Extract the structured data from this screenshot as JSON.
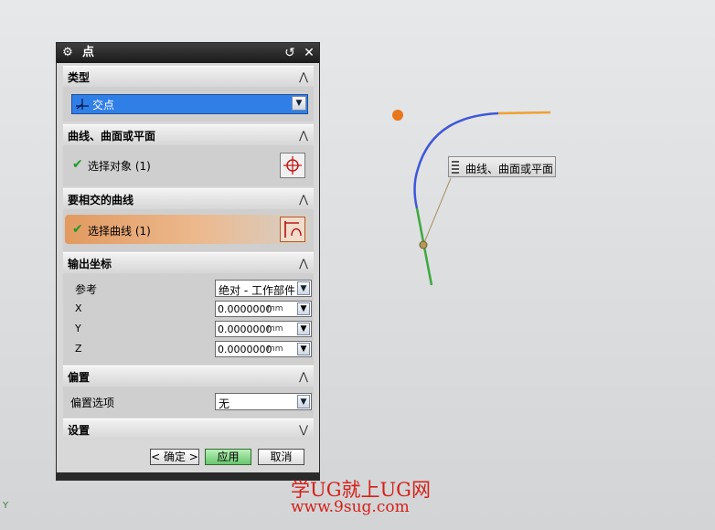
{
  "dialog": {
    "title": "点",
    "sections": {
      "type": {
        "label": "类型",
        "combo_value": "交点"
      },
      "curve_surface": {
        "label": "曲线、曲面或平面",
        "select_label": "选择对象 (1)"
      },
      "intersect_curve": {
        "label": "要相交的曲线",
        "select_label": "选择曲线 (1)"
      },
      "output_coords": {
        "label": "输出坐标",
        "reference_label": "参考",
        "reference_value": "绝对 - 工作部件",
        "rows": [
          {
            "axis": "X",
            "value": "0.0000000",
            "unit": "mm"
          },
          {
            "axis": "Y",
            "value": "0.0000000",
            "unit": "mm"
          },
          {
            "axis": "Z",
            "value": "0.0000000",
            "unit": "mm"
          }
        ]
      },
      "offset": {
        "label": "偏置",
        "option_label": "偏置选项",
        "option_value": "无"
      },
      "settings": {
        "label": "设置"
      }
    },
    "buttons": {
      "ok": "< 确定 >",
      "apply": "应用",
      "cancel": "取消"
    }
  },
  "viewport": {
    "tooltip": "曲线、曲面或平面",
    "axis_label": "Y",
    "colors": {
      "arc": "#3f57d8",
      "line_orange": "#f0a030",
      "line_green": "#3ea83e",
      "point": "#e8761c"
    }
  },
  "watermark": {
    "line1": "学UG就上UG网",
    "line2": "www.9sug.com"
  },
  "icons": [
    "gear-icon",
    "reset-icon",
    "close-icon",
    "collapse-icon",
    "expand-icon",
    "crosshair-icon",
    "curve-select-icon",
    "check-icon"
  ]
}
